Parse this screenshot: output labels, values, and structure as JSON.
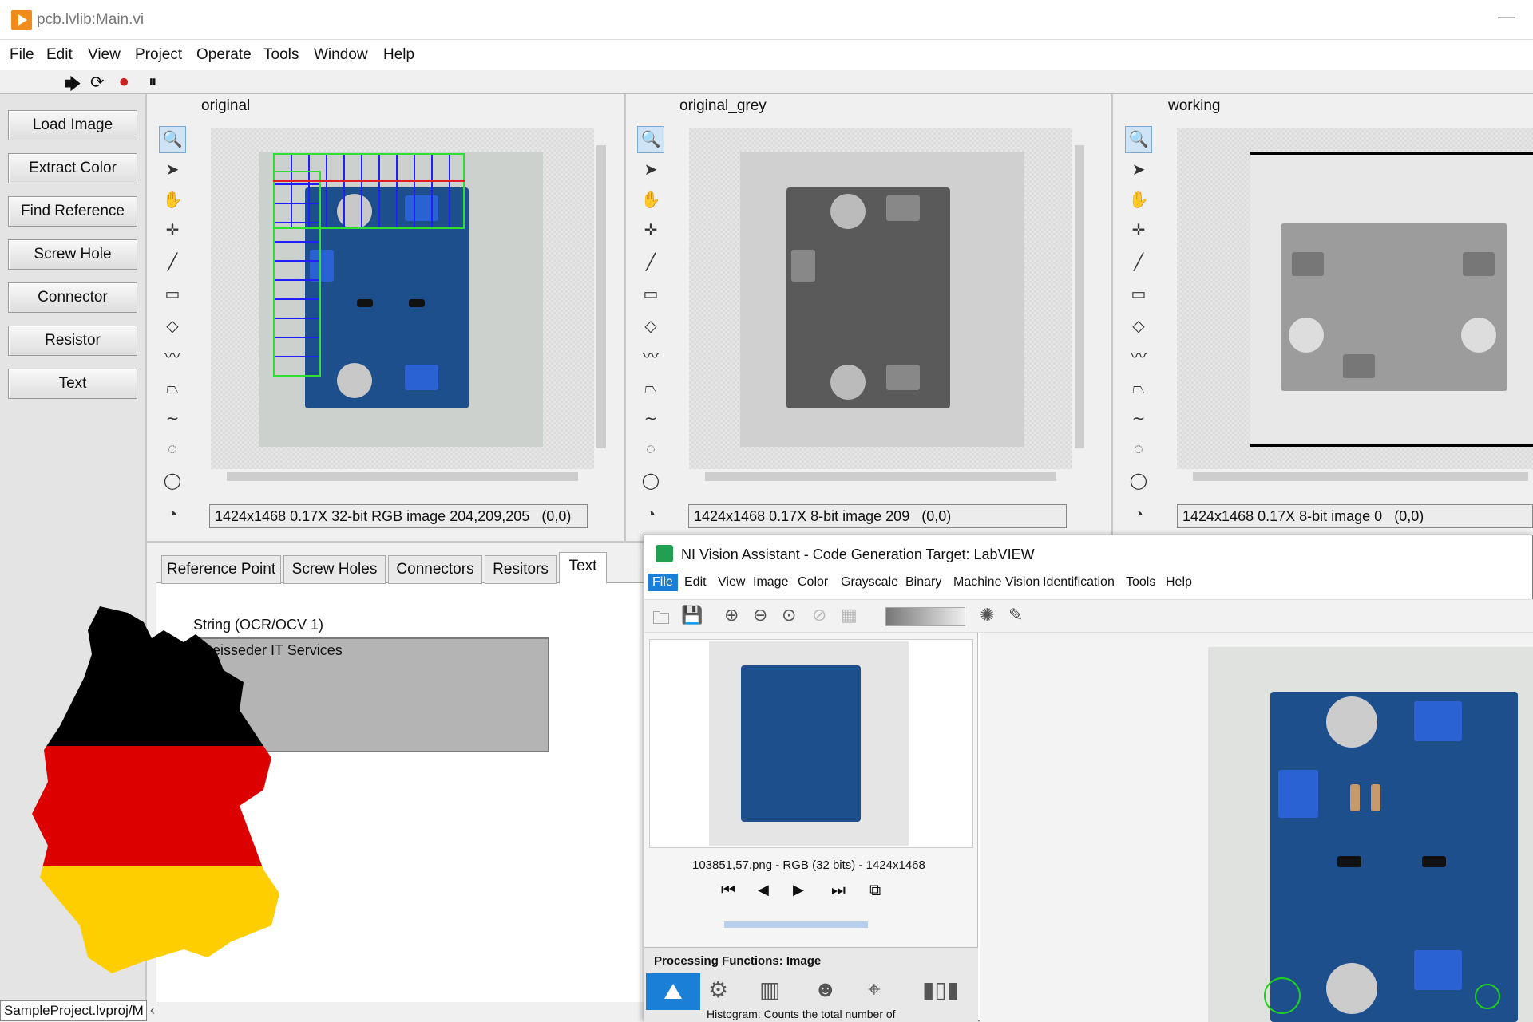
{
  "window": {
    "title": "pcb.lvlib:Main.vi",
    "minimize": "—"
  },
  "menu": [
    "File",
    "Edit",
    "View",
    "Project",
    "Operate",
    "Tools",
    "Window",
    "Help"
  ],
  "toolbar": {
    "run": "🡆",
    "run_cont": "⟳",
    "abort": "⏺",
    "pause": "⏸"
  },
  "left_buttons": [
    "Load Image",
    "Extract Color",
    "Find Reference",
    "Screw Hole",
    "Connector",
    "Resistor",
    "Text"
  ],
  "panels": [
    {
      "label": "original",
      "status": "1424x1468 0.17X 32-bit RGB image 204,209,205",
      "coord": "(0,0)"
    },
    {
      "label": "original_grey",
      "status": "1424x1468 0.17X 8-bit image 209",
      "coord": "(0,0)"
    },
    {
      "label": "working",
      "status": "1424x1468 0.17X 8-bit image 0",
      "coord": "(0,0)"
    }
  ],
  "tool_icons": [
    "zoom-icon",
    "pointer-icon",
    "pan-icon",
    "crosshair-icon",
    "line-icon",
    "rectangle-icon",
    "rotated-rect-icon",
    "freeline-icon",
    "polygon-icon",
    "freehand-icon",
    "annulus-icon",
    "oval-icon",
    "arc-icon"
  ],
  "tabs": [
    "Reference Point",
    "Screw Holes",
    "Connectors",
    "Resitors",
    "Text"
  ],
  "active_tab": "Text",
  "text_tab": {
    "label": "String (OCR/OCV 1)",
    "value": "Kreisseder IT Services"
  },
  "project_bar": "SampleProject.lvproj/M",
  "nva": {
    "title": "NI Vision Assistant - Code Generation Target: LabVIEW",
    "menu": [
      "File",
      "Edit",
      "View",
      "Image",
      "Color",
      "Grayscale",
      "Binary",
      "Machine Vision",
      "Identification",
      "Tools",
      "Help"
    ],
    "thumb_caption": "103851,57.png - RGB (32 bits) - 1424x1468",
    "proc_title": "Processing Functions: Image",
    "histogram_text": "Histogram:  Counts the total number of"
  },
  "colors": {
    "pcb_blue": "#1d4f8c",
    "flag_black": "#000000",
    "flag_red": "#dd0000",
    "flag_gold": "#ffce00"
  }
}
